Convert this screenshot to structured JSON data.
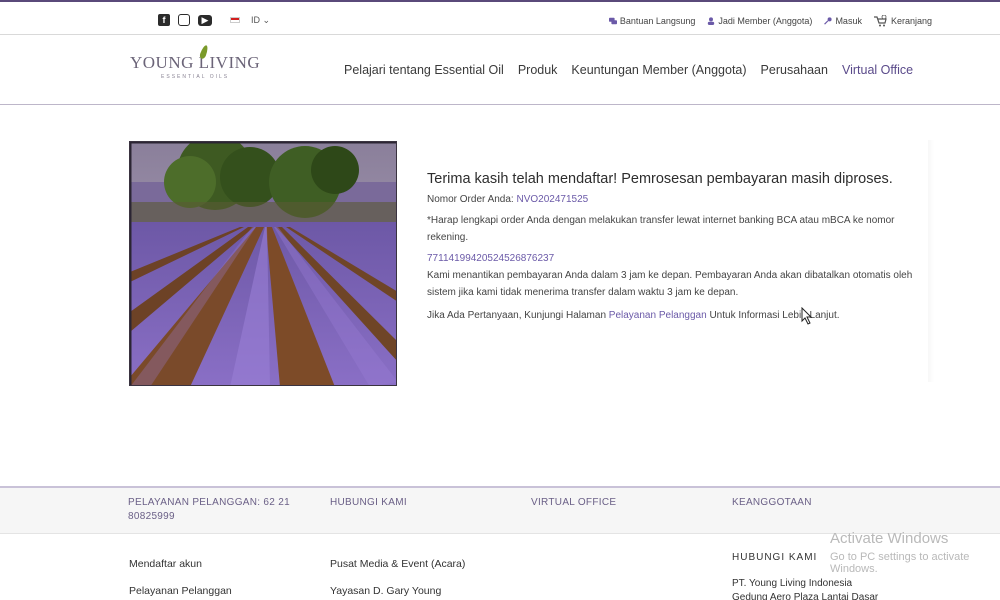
{
  "topbar": {
    "social_icons": [
      "facebook-icon",
      "instagram-icon",
      "youtube-icon"
    ],
    "language": "ID",
    "links": [
      {
        "icon": "chat-icon",
        "label": "Bantuan Langsung"
      },
      {
        "icon": "user-icon",
        "label": "Jadi Member (Anggota)"
      },
      {
        "icon": "key-icon",
        "label": "Masuk"
      },
      {
        "icon": "cart-icon",
        "label": "Keranjang",
        "badge": "0"
      }
    ]
  },
  "header": {
    "logo_text": "YOUNG LIVING",
    "logo_sub": "ESSENTIAL OILS",
    "nav": [
      "Pelajari tentang Essential Oil",
      "Produk",
      "Keuntungan Member (Anggota)",
      "Perusahaan",
      "Virtual Office"
    ]
  },
  "main": {
    "headline": "Terima kasih telah mendaftar! Pemrosesan pembayaran masih diproses.",
    "order_label": "Nomor Order Anda:",
    "order_number": "NVO202471525",
    "instruction": "*Harap lengkapi order Anda dengan melakukan transfer lewat internet banking BCA atau mBCA ke nomor rekening.",
    "account_number": "77114199420524526876237",
    "wait_text": "Kami menantikan pembayaran Anda dalam 3 jam ke depan. Pembayaran Anda akan dibatalkan otomatis oleh sistem jika kami tidak menerima transfer dalam waktu 3 jam ke depan.",
    "question_prefix": "Jika Ada Pertanyaan, Kunjungi Halaman",
    "question_link": "Pelayanan Pelanggan",
    "question_suffix": "Untuk Informasi Lebih Lanjut."
  },
  "footer": {
    "columns": [
      "PELAYANAN PELANGGAN: 62 21 80825999",
      "HUBUNGI KAMI",
      "VIRTUAL OFFICE",
      "KEANGGOTAAN"
    ],
    "col1_links": [
      "Mendaftar akun",
      "Pelayanan Pelanggan"
    ],
    "col2_links": [
      "Pusat Media & Event (Acara)",
      "Yayasan D. Gary Young"
    ],
    "contact_heading": "HUBUNGI KAMI",
    "contact_lines": [
      "PT. Young Living Indonesia",
      "Gedung Aero Plaza Lantai Dasar"
    ]
  },
  "watermark": {
    "title": "Activate Windows",
    "subtitle": "Go to PC settings to activate Windows."
  },
  "colors": {
    "accent": "#6b5aa8",
    "footer_line": "#c9c2d8"
  }
}
